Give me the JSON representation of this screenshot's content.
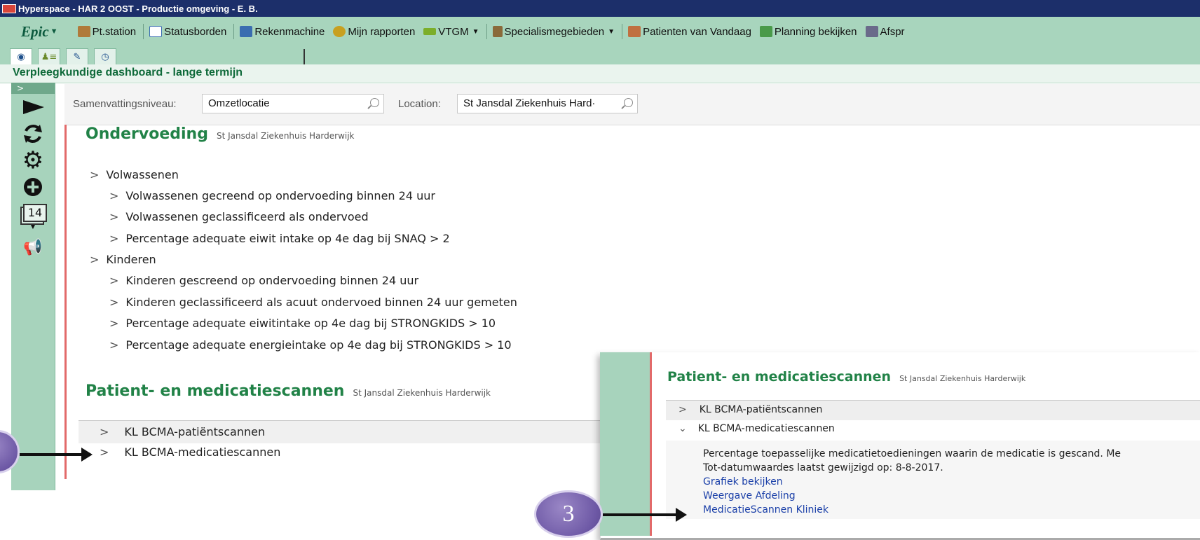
{
  "window": {
    "title": "Hyperspace - HAR 2 OOST - Productie omgeving - E. B."
  },
  "toolbar": {
    "epic_label": "Epic",
    "items": [
      {
        "label": "Pt.station",
        "icon": "station-icon",
        "color": "#b07a3a"
      },
      {
        "label": "Statusborden",
        "icon": "board-icon",
        "color": "#3a6db0"
      },
      {
        "label": "Rekenmachine",
        "icon": "calculator-icon",
        "color": "#3a6db0"
      },
      {
        "label": "Mijn rapporten",
        "icon": "reports-icon",
        "color": "#c8a020"
      },
      {
        "label": "VTGM",
        "icon": "ruler-icon",
        "color": "#7cae2a"
      },
      {
        "label": "Specialismegebieden",
        "icon": "specialism-icon",
        "color": "#8a6a3a"
      },
      {
        "label": "Patienten van Vandaag",
        "icon": "patients-icon",
        "color": "#c07040"
      },
      {
        "label": "Planning bekijken",
        "icon": "planning-icon",
        "color": "#4a9a4a"
      },
      {
        "label": "Afspr",
        "icon": "appointments-icon",
        "color": "#6a6a8a"
      }
    ]
  },
  "dashboard": {
    "title": "Verpleegkundige dashboard - lange termijn"
  },
  "filters": {
    "level_label": "Samenvattingsniveau:",
    "level_value": "Omzetlocatie",
    "location_label": "Location:",
    "location_value": "St Jansdal Ziekenhuis Hard·"
  },
  "sidebar": {
    "badge_count": "14"
  },
  "ondervoeding": {
    "title": "Ondervoeding",
    "subtitle": "St Jansdal Ziekenhuis Harderwijk",
    "groups": [
      {
        "label": "Volwassenen",
        "items": [
          "Volwassenen gecreend op ondervoeding binnen 24 uur",
          "Volwassenen geclassificeerd als ondervoed",
          "Percentage adequate eiwit intake op 4e dag bij SNAQ > 2"
        ]
      },
      {
        "label": "Kinderen",
        "items": [
          "Kinderen gescreend op ondervoeding binnen 24 uur",
          "Kinderen geclassificeerd als acuut ondervoed binnen 24 uur gemeten",
          "Percentage adequate eiwitintake op 4e dag bij STRONGKIDS > 10",
          "Percentage adequate energieintake op 4e dag bij STRONGKIDS > 10"
        ]
      }
    ]
  },
  "scannen": {
    "title": "Patient- en medicatiescannen",
    "subtitle": "St Jansdal Ziekenhuis Harderwijk",
    "items": [
      "KL BCMA-patiëntscannen",
      "KL BCMA-medicatiescannen"
    ]
  },
  "inset": {
    "title": "Patient- en medicatiescannen",
    "subtitle": "St Jansdal Ziekenhuis Harderwijk",
    "items": [
      "KL BCMA-patiëntscannen",
      "KL BCMA-medicatiescannen"
    ],
    "description": "Percentage toepasselijke medicatietoedieningen waarin de medicatie is gescand. Me",
    "date_note": "Tot-datumwaardes laatst gewijzigd op: 8-8-2017.",
    "links": [
      "Grafiek bekijken",
      "Weergave Afdeling",
      "MedicatieScannen Kliniek"
    ]
  },
  "callouts": {
    "three": "3"
  }
}
